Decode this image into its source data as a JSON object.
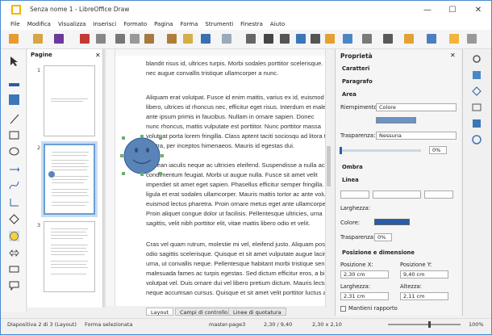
{
  "window": {
    "title": "Senza nome 1 - LibreOffice Draw"
  },
  "menu": [
    "File",
    "Modifica",
    "Visualizza",
    "Inserisci",
    "Formato",
    "Pagina",
    "Forma",
    "Strumenti",
    "Finestra",
    "Aiuto"
  ],
  "pages_panel": {
    "title": "Pagine",
    "numbers": [
      "1",
      "2",
      "3"
    ]
  },
  "document_text": [
    "blandit risus id, ultrices turpis. Morbi sodales porttitor scelerisque.",
    "nec augue convallis tristique ullamcorper a nunc.",
    "Aliquam erat volutpat. Fusce id enim mattis, varius ex id, euismod",
    "libero, ultrices id rhoncus nec, efficitur eget risus. Interdum et malesuada",
    "ante ipsum primis in faucibus. Nullam in ornare sapien. Donec",
    "nunc rhoncus, mattis vulputate est porttitor. Nunc porttitor massa",
    "volutpat porta lorem fringilla. Class aptent taciti sociosqu ad litora torquent",
    "nostra, per inceptos himenaeos. Mauris id egestas dui.",
    "Aenean iaculis neque ac ultricies eleifend. Suspendisse a nulla ac",
    "condimentum feugiat. Morbi ut augue nulla. Fusce sit amet velit",
    "imperdiet sit amet eget sapien. Phasellus efficitur semper fringilla.",
    "ligula et erat sodales ullamcorper. Mauris mattis tortor ac ante volutpat,",
    "euismod lectus pharetra. Proin ornare metus eget ante ullamcorper,",
    "Proin aliquet congue dolor ut facilisis. Pellentesque ultricies, urna",
    "sagittis, velit nibh porttitor elit, vitae mattis libero odio et velit.",
    "Cras vel quam rutrum, molestie mi vel, eleifend justo. Aliquam posuere",
    "odio sagittis scelerisque. Quisque et sit amet vulputate augue lacinia sit",
    "urna, ut convallis neque. Pellentesque habitant morbi tristique senectus",
    "malesuada fames ac turpis egestas. Sed dictum efficitur eros, a bibendum",
    "volutpat vel. Duis ornare dui vel libero pretium dictum. Mauris lectus",
    "neque accumsan cursus. Quisque et sit amet velit porttitor luctus at"
  ],
  "tabs": [
    "Layout",
    "Campi di controllo",
    "Linee di quotatura"
  ],
  "properties": {
    "title": "Proprietà",
    "caratteri": "Caratteri",
    "paragrafo": "Paragrafo",
    "area": "Area",
    "riempimento_label": "Riempimento:",
    "riempimento_value": "Colore",
    "trasparenza_label": "Trasparenza:",
    "trasparenza_value": "Nessuna",
    "transparency_percent": "0%",
    "ombra": "Ombra",
    "linea": "Linea",
    "larghezza_label": "Larghezza:",
    "colore_label": "Colore:",
    "trasparenza2_label": "Trasparenza:",
    "trasparenza2_value": "0%",
    "posizione_title": "Posizione e dimensione",
    "pos_x_label": "Posizione X:",
    "pos_x": "2,30 cm",
    "pos_y_label": "Posizione Y:",
    "pos_y": "9,40 cm",
    "larghezza2_label": "Larghezza:",
    "larghezza2": "2,31 cm",
    "altezza_label": "Altezza:",
    "altezza": "2,11 cm",
    "keep_ratio": "Mantieni rapporto"
  },
  "status": {
    "slide": "Diapositiva 2 di 3 (Layout)",
    "selection": "Forma selezionata",
    "master": "master-page3",
    "pos": "2,30 / 9,40",
    "size": "2,30 x 2,10",
    "zoom": "100%"
  },
  "colors": {
    "accent": "#2a5da8",
    "fill": "#6b93c4",
    "smiley": "#5a84b8"
  }
}
